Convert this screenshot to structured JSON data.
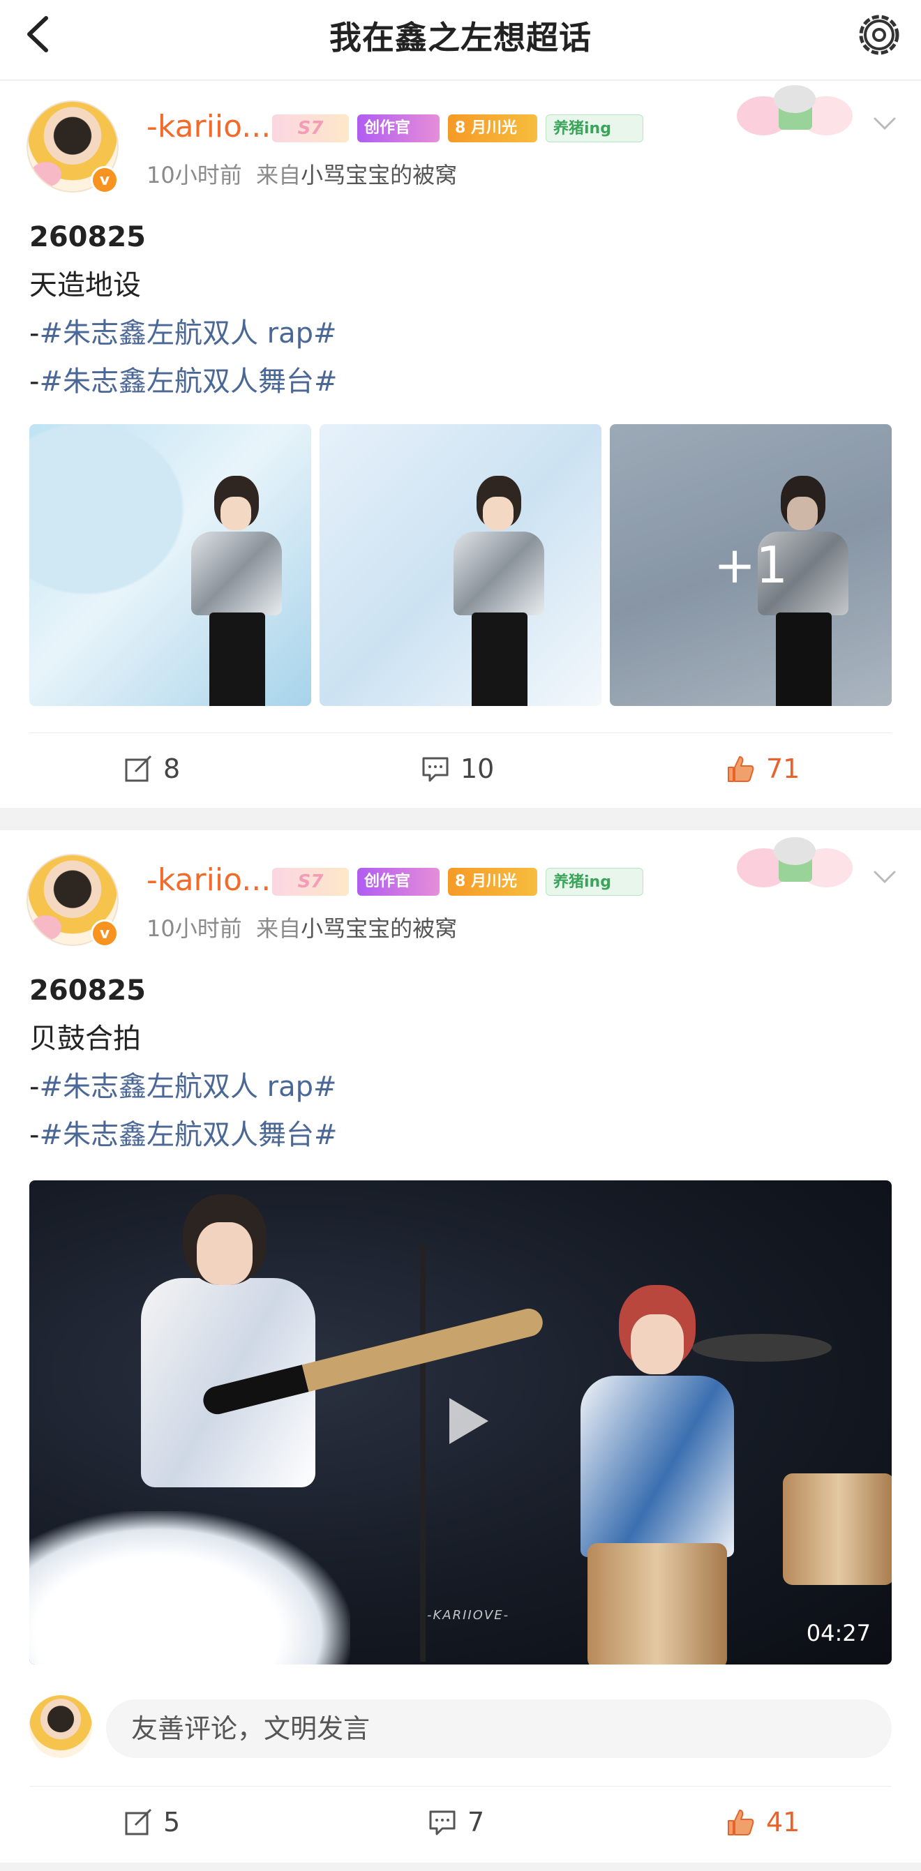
{
  "header": {
    "title": "我在鑫之左想超话"
  },
  "posts": [
    {
      "username": "-kariio...",
      "badges": {
        "level": "S7",
        "creator": "创作官",
        "moon_num": "8",
        "moon": "月川光",
        "pig": "养猪ing"
      },
      "time": "10小时前",
      "from_prefix": "来自",
      "source": "小骂宝宝的被窝",
      "date": "260825",
      "title": "天造地设",
      "tags": [
        "#朱志鑫左航双人 rap#",
        "#朱志鑫左航双人舞台#"
      ],
      "more_photos": "+1",
      "reposts": "8",
      "comments": "10",
      "likes": "71"
    },
    {
      "username": "-kariio...",
      "badges": {
        "level": "S7",
        "creator": "创作官",
        "moon_num": "8",
        "moon": "月川光",
        "pig": "养猪ing"
      },
      "time": "10小时前",
      "from_prefix": "来自",
      "source": "小骂宝宝的被窝",
      "date": "260825",
      "title": "贝鼓合拍",
      "tags": [
        "#朱志鑫左航双人 rap#",
        "#朱志鑫左航双人舞台#"
      ],
      "video_duration": "04:27",
      "video_watermark": "-KARIIOVE-",
      "comment_placeholder": "友善评论，文明发言",
      "reposts": "5",
      "comments": "7",
      "likes": "41"
    }
  ],
  "colors": {
    "username": "#f26b2a",
    "tag": "#4a6796",
    "like": "#e8632b"
  }
}
